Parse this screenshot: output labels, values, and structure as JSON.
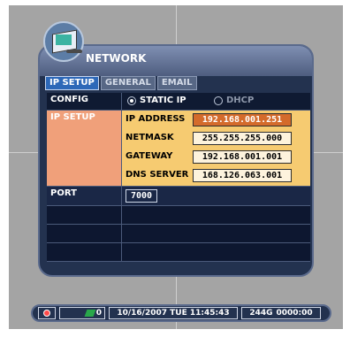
{
  "window": {
    "title": "NETWORK"
  },
  "tabs": [
    {
      "label": "IP SETUP",
      "active": true
    },
    {
      "label": "GENERAL",
      "active": false
    },
    {
      "label": "EMAIL",
      "active": false
    }
  ],
  "config": {
    "label": "CONFIG",
    "options": [
      {
        "label": "STATIC IP",
        "selected": true
      },
      {
        "label": "DHCP",
        "selected": false
      }
    ]
  },
  "ip_setup": {
    "label": "IP SETUP",
    "fields": [
      {
        "label": "IP ADDRESS",
        "value": "192.168.001.251",
        "editing": true
      },
      {
        "label": "NETMASK",
        "value": "255.255.255.000",
        "editing": false
      },
      {
        "label": "GATEWAY",
        "value": "192.168.001.001",
        "editing": false
      },
      {
        "label": "DNS SERVER",
        "value": "168.126.063.001",
        "editing": false
      }
    ]
  },
  "port": {
    "label": "PORT",
    "value": "7000"
  },
  "status_bar": {
    "rec_count": "0",
    "datetime": "10/16/2007 TUE 11:45:43",
    "disk": "244G",
    "timer": "0000:00"
  },
  "colors": {
    "accent_active_tab": "#2d68b8",
    "ip_section_left": "#f0a07a",
    "ip_section_right": "#f6cb71",
    "panel_bg": "#23324f"
  },
  "icons": {
    "logo": "network-computer-icon",
    "record": "record-icon",
    "network": "network-status-icon"
  }
}
